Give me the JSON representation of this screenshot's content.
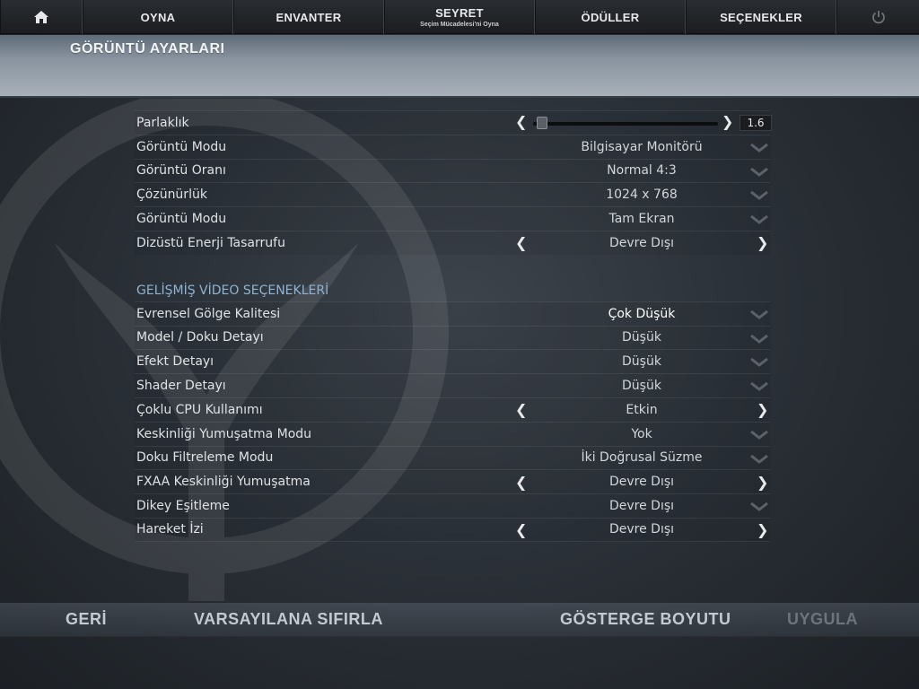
{
  "nav": {
    "items": [
      {
        "label": "OYNA"
      },
      {
        "label": "ENVANTER"
      },
      {
        "label": "SEYRET",
        "sub": "Seçim Mücadelesi'ni Oyna"
      },
      {
        "label": "ÖDÜLLER"
      },
      {
        "label": "SEÇENEKLER"
      }
    ]
  },
  "page": {
    "title": "GÖRÜNTÜ AYARLARI"
  },
  "display": {
    "brightness": {
      "label": "Parlaklık",
      "value": "1.6",
      "fraction": 0.02
    },
    "rows": [
      {
        "label": "Görüntü Modu",
        "value": "Bilgisayar Monitörü"
      },
      {
        "label": "Görüntü Oranı",
        "value": "Normal 4:3"
      },
      {
        "label": "Çözünürlük",
        "value": "1024 x 768"
      },
      {
        "label": "Görüntü Modu",
        "value": "Tam Ekran"
      },
      {
        "label": "Dizüstü Enerji Tasarrufu",
        "value": "Devre Dışı"
      }
    ]
  },
  "advanced": {
    "heading": "GELİŞMİŞ VİDEO SEÇENEKLERİ",
    "rows": [
      {
        "label": "Evrensel Gölge Kalitesi",
        "value": "Çok Düşük"
      },
      {
        "label": "Model / Doku Detayı",
        "value": "Düşük"
      },
      {
        "label": "Efekt Detayı",
        "value": "Düşük"
      },
      {
        "label": "Shader Detayı",
        "value": "Düşük"
      },
      {
        "label": "Çoklu CPU Kullanımı",
        "value": "Etkin"
      },
      {
        "label": "Keskinliği Yumuşatma Modu",
        "value": "Yok"
      },
      {
        "label": "Doku Filtreleme Modu",
        "value": "İki Doğrusal Süzme"
      },
      {
        "label": "FXAA Keskinliği Yumuşatma",
        "value": "Devre Dışı"
      },
      {
        "label": "Dikey Eşitleme",
        "value": "Devre Dışı"
      },
      {
        "label": "Hareket İzi",
        "value": "Devre Dışı"
      }
    ]
  },
  "bottom": {
    "back": "GERİ",
    "reset": "VARSAYILANA SIFIRLA",
    "hud_size": "GÖSTERGE BOYUTU",
    "apply": "UYGULA"
  }
}
